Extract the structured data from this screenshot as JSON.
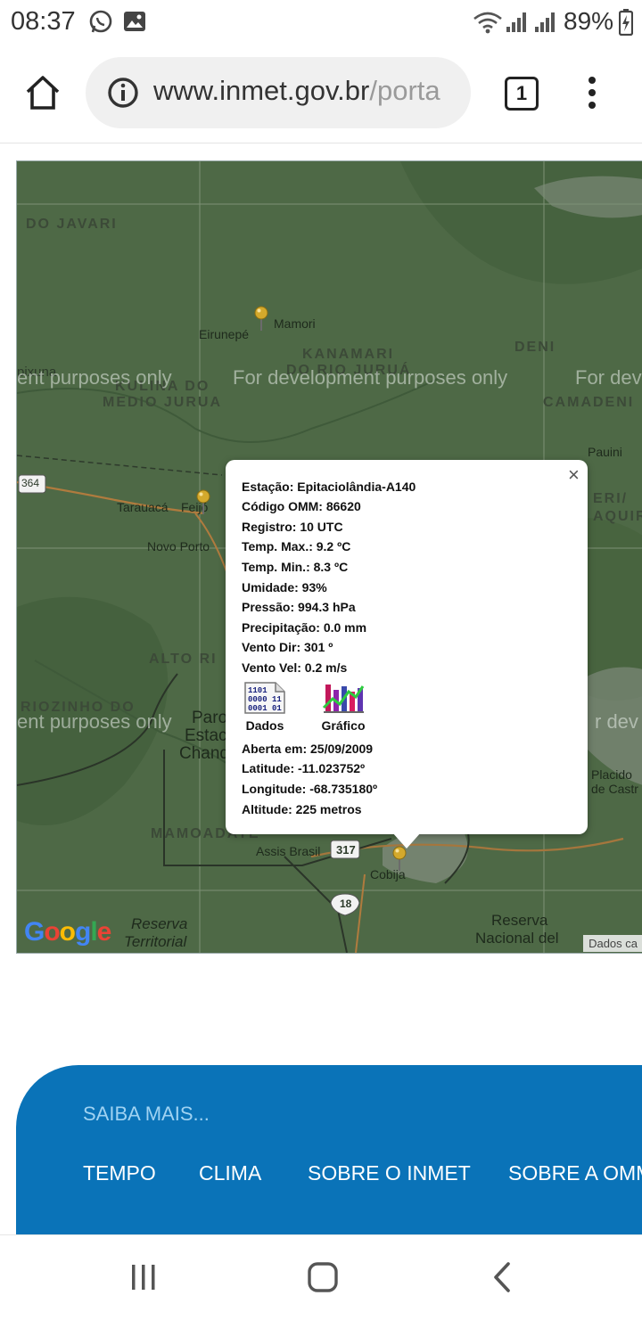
{
  "status_bar": {
    "time": "08:37",
    "battery": "89%",
    "icons": [
      "whatsapp-icon",
      "image-icon",
      "wifi-icon",
      "signal-icon",
      "signal-icon",
      "battery-icon"
    ]
  },
  "browser": {
    "url_host": "www.inmet.gov.br",
    "url_path": "/porta",
    "tab_count": "1"
  },
  "map": {
    "watermark": "For development purposes only",
    "watermark_left": "ent purposes only",
    "watermark_right": "For dev",
    "watermark_right2": "r dev",
    "labels": {
      "do_javari": "DO JAVARI",
      "mamori": "Mamori",
      "eirunepe": "Eirunepé",
      "kanamari": "KANAMARI",
      "do_rio_jurua": "DO RIO JURUÁ",
      "deni": "DENI",
      "kulina": "KULINA DO",
      "medio_jurua": "MEDIO JURUA",
      "camadeni": "CAMADENI",
      "ipixuna": "pixuna",
      "pauini": "Pauini",
      "road_364": "364",
      "tarauaca": "Tarauacá",
      "feijo": "Feijó",
      "novo_porto": "Novo Porto",
      "alto_ri": "ALTO RI",
      "riozinho": "RIOZINHO DO",
      "paro": "Paro",
      "estac": "Estac",
      "chand": "Chand",
      "placido": "Placido",
      "de_castr": "de Castr",
      "mamoadate": "MAMOADATE",
      "assis_brasil": "Assis Brasil",
      "road_317": "317",
      "cobija": "Cobija",
      "road_18": "18",
      "reserva_territorial_1": "Reserva",
      "reserva_territorial_2": "Territorial",
      "reserva_nacional_1": "Reserva",
      "reserva_nacional_2": "Nacional del",
      "eri_aqui": "ERI/",
      "aqui": "AQUIR"
    },
    "google": "Google",
    "attribution": "Dados ca"
  },
  "popup": {
    "close": "×",
    "lines": [
      "Estação: Epitaciolândia-A140",
      "Código OMM: 86620",
      "Registro: 10 UTC",
      "Temp. Max.: 9.2 ºC",
      "Temp. Min.: 8.3 ºC",
      "Umidade: 93%",
      "Pressão: 994.3 hPa",
      "Precipitação: 0.0 mm",
      "Vento Dir: 301 º",
      "Vento Vel: 0.2 m/s"
    ],
    "dados_label": "Dados",
    "grafico_label": "Gráfico",
    "details": [
      "Aberta em: 25/09/2009",
      "Latitude: -11.023752º",
      "Longitude: -68.735180º",
      "Altitude: 225 metros"
    ]
  },
  "footer": {
    "title": "SAIBA MAIS...",
    "links": [
      "TEMPO",
      "CLIMA",
      "SOBRE O INMET",
      "SOBRE A OMM"
    ]
  },
  "colors": {
    "map_green": "#4f6a47",
    "footer_blue": "#0a73b8",
    "footer_title": "#9fd2f2"
  }
}
